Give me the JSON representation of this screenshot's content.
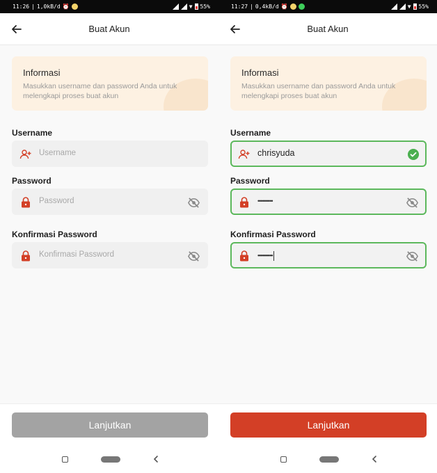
{
  "screens": [
    {
      "status": {
        "time": "11:26",
        "speed": "1,0kB/d",
        "battery": "55%"
      },
      "appbar": {
        "title": "Buat Akun"
      },
      "info": {
        "title": "Informasi",
        "text": "Masukkan username dan password Anda untuk melengkapi proses buat akun"
      },
      "fields": {
        "username": {
          "label": "Username",
          "placeholder": "Username",
          "value": ""
        },
        "password": {
          "label": "Password",
          "placeholder": "Password",
          "value": ""
        },
        "confirm": {
          "label": "Konfirmasi Password",
          "placeholder": "Konfirmasi Password",
          "value": ""
        }
      },
      "button": {
        "label": "Lanjutkan",
        "state": "disabled",
        "color": "#a3a3a3"
      }
    },
    {
      "status": {
        "time": "11:27",
        "speed": "0,4kB/d",
        "battery": "55%"
      },
      "appbar": {
        "title": "Buat Akun"
      },
      "info": {
        "title": "Informasi",
        "text": "Masukkan username dan password Anda untuk melengkapi proses buat akun"
      },
      "fields": {
        "username": {
          "label": "Username",
          "placeholder": "Username",
          "value": "chrisyuda",
          "valid": true
        },
        "password": {
          "label": "Password",
          "placeholder": "Password",
          "value": "••••••••••"
        },
        "confirm": {
          "label": "Konfirmasi Password",
          "placeholder": "Konfirmasi Password",
          "value": "••••••••••"
        }
      },
      "button": {
        "label": "Lanjutkan",
        "state": "enabled",
        "color": "#d33f26"
      }
    }
  ],
  "colors": {
    "accent": "#d33f26",
    "valid_border": "#5cb85c",
    "info_bg": "#fdf1e2",
    "icon_red": "#d33f26"
  }
}
